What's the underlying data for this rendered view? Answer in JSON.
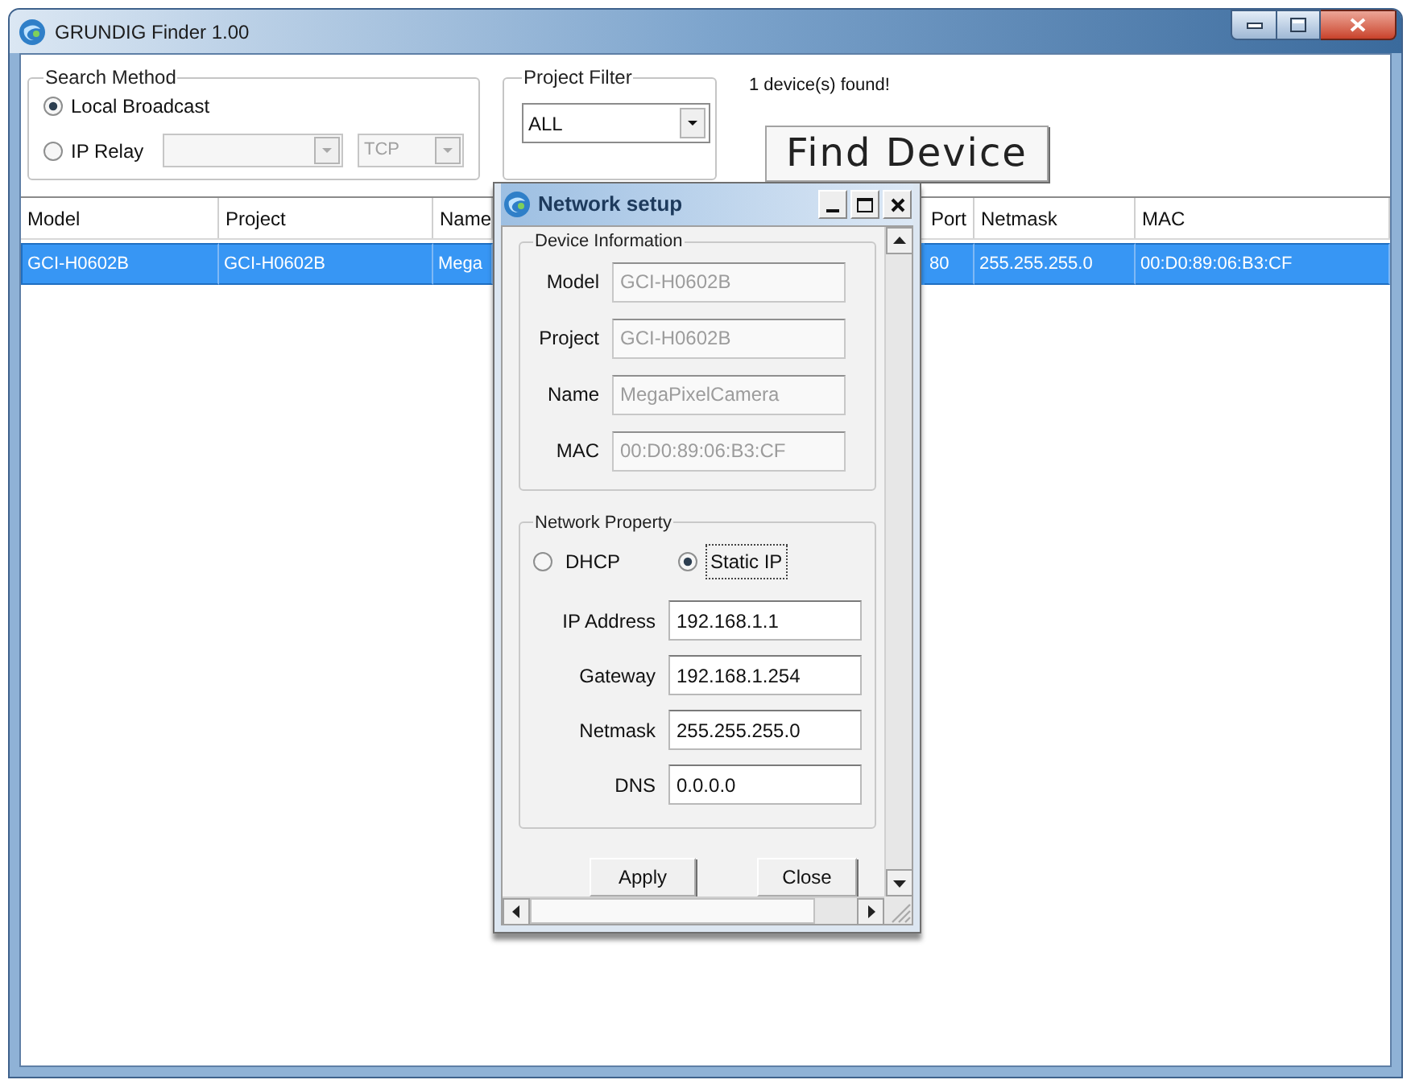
{
  "window": {
    "title": "GRUNDIG Finder 1.00"
  },
  "search_method": {
    "label": "Search Method",
    "options": [
      {
        "label": "Local Broadcast",
        "selected": true
      },
      {
        "label": "IP Relay",
        "selected": false
      }
    ],
    "relay_address": {
      "disabled": true
    },
    "protocol": {
      "value": "TCP",
      "disabled": true
    }
  },
  "project_filter": {
    "label": "Project Filter",
    "value": "ALL"
  },
  "status": "1 device(s) found!",
  "find_button": {
    "label": "Find Device"
  },
  "table": {
    "columns": [
      "Model",
      "Project",
      "Name",
      "Port",
      "Netmask",
      "MAC"
    ],
    "rows": [
      {
        "selected": true,
        "cells": [
          "GCI-H0602B",
          "GCI-H0602B",
          "Mega",
          "80",
          "255.255.255.0",
          "00:D0:89:06:B3:CF"
        ]
      }
    ]
  },
  "dialog": {
    "title": "Network setup",
    "device_information": {
      "label": "Device Information",
      "fields": [
        {
          "label": "Model",
          "value": "GCI-H0602B",
          "disabled": true
        },
        {
          "label": "Project",
          "value": "GCI-H0602B",
          "disabled": true
        },
        {
          "label": "Name",
          "value": "MegaPixelCamera",
          "disabled": true
        },
        {
          "label": "MAC",
          "value": "00:D0:89:06:B3:CF",
          "disabled": true
        }
      ]
    },
    "network_property": {
      "label": "Network Property",
      "modes": [
        {
          "label": "DHCP",
          "selected": false,
          "focused": false
        },
        {
          "label": "Static IP",
          "selected": true,
          "focused": true
        }
      ],
      "fields": [
        {
          "label": "IP Address",
          "value": "192.168.1.1",
          "disabled": false
        },
        {
          "label": "Gateway",
          "value": "192.168.1.254",
          "disabled": false
        },
        {
          "label": "Netmask",
          "value": "255.255.255.0",
          "disabled": false
        },
        {
          "label": "DNS",
          "value": "0.0.0.0",
          "disabled": false
        }
      ]
    },
    "buttons": [
      {
        "label": "Apply"
      },
      {
        "label": "Close"
      }
    ]
  }
}
